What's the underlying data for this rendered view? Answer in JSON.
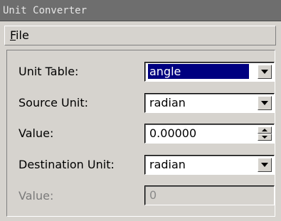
{
  "window": {
    "title": "Unit Converter"
  },
  "menubar": {
    "file": {
      "accel": "F",
      "rest": "ile"
    }
  },
  "form": {
    "unit_table": {
      "label": "Unit Table:",
      "value": "angle"
    },
    "source_unit": {
      "label": "Source Unit:",
      "value": "radian"
    },
    "value": {
      "label": "Value:",
      "value": "0.00000"
    },
    "destination_unit": {
      "label": "Destination Unit:",
      "value": "radian"
    },
    "result": {
      "label": "Value:",
      "value": "0"
    }
  },
  "colors": {
    "titlebar": "#6e6e6e",
    "window_bg": "#d6d3ce",
    "selection": "#000080"
  }
}
